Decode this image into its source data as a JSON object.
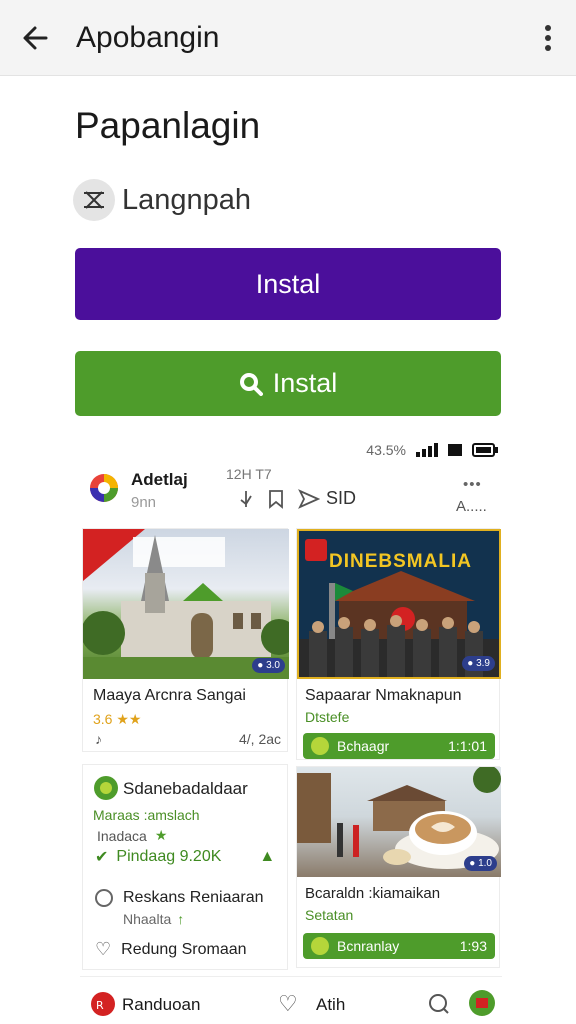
{
  "appbar": {
    "title": "Apobangin",
    "back_icon": "arrow-left-icon",
    "menu_icon": "more-vert-icon"
  },
  "app": {
    "name": "Papanlagin",
    "developer": "Langnpah"
  },
  "buttons": {
    "install_primary": "Instal",
    "install_secondary": "Instal"
  },
  "colors": {
    "purple": "#4b0f9b",
    "green": "#4e9c2b"
  },
  "preview": {
    "status": {
      "battery_text": "43.5%"
    },
    "header": {
      "name": "Adetlaj",
      "sub": "9nn",
      "time": "12H T7",
      "count": "SID",
      "more": "•••",
      "right": "A....."
    },
    "cards": [
      {
        "title": "Maaya Arcnra Sangai",
        "rating": "3.6 ★★",
        "meta_left": "♪",
        "meta_right": "4/, 2ac",
        "badge": "● 3.0"
      },
      {
        "title": "Sapaarar Nmaknapun",
        "sub": "Dtstefe",
        "pill_label": "Bchaagr",
        "pill_value": "1:1:01",
        "banner_title": "DINEBSMALIA",
        "badge": "● 3.9"
      },
      {
        "title": "Sdanebadaldaar",
        "line1": "Maraas :amslach",
        "line2": "Inadaca",
        "line3": "Pindaag 9.20K",
        "line4": "Reskans Reniaaran",
        "line5": "Nhaalta",
        "line6": "Redung Sromaan"
      },
      {
        "title": "Bcaraldn :kiamaikan",
        "sub": "Setatan",
        "pill_label": "Bcnranlay",
        "pill_value": "1:93",
        "badge": "● 1.0"
      }
    ],
    "bottom": {
      "left": "Randuoan",
      "mid": "Atih"
    }
  }
}
